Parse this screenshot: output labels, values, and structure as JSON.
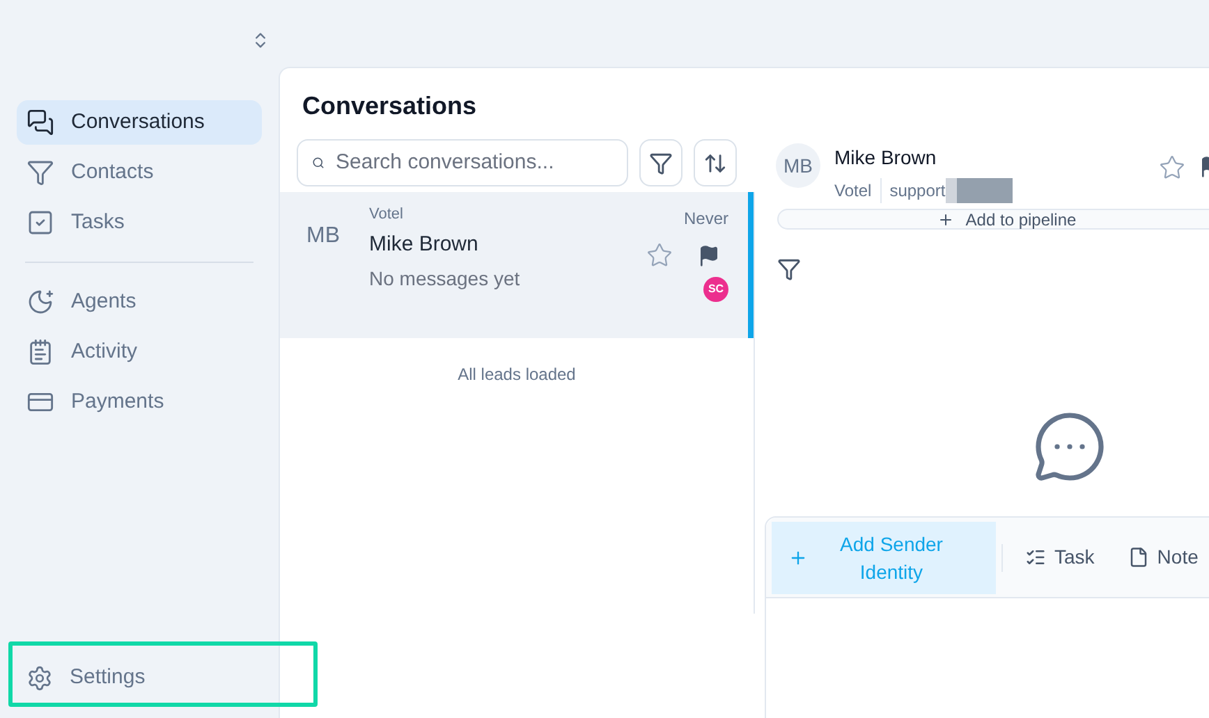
{
  "sidebar": {
    "items": [
      {
        "label": "Conversations",
        "selected": true
      },
      {
        "label": "Contacts",
        "selected": false
      },
      {
        "label": "Tasks",
        "selected": false
      }
    ],
    "items_2": [
      {
        "label": "Agents",
        "selected": false
      },
      {
        "label": "Activity",
        "selected": false
      },
      {
        "label": "Payments",
        "selected": false
      }
    ],
    "settings": {
      "label": "Settings",
      "highlighted": true
    }
  },
  "conversations": {
    "title": "Conversations",
    "search": {
      "placeholder": "Search conversations..."
    },
    "rows": [
      {
        "initials": "MB",
        "company": "Votel",
        "name": "Mike Brown",
        "preview": "No messages yet",
        "time": "Never",
        "selected": true,
        "starred": false,
        "agent": {
          "initials": "SC",
          "color": "#ec2f8e"
        }
      }
    ],
    "footer": "All leads loaded"
  },
  "chat": {
    "initials": "MB",
    "name": "Mike Brown",
    "company": "Votel",
    "email": "support",
    "starred": false,
    "pipeline_button": "Add to pipeline",
    "composer": {
      "sender_button": "Add Sender Identity",
      "tabs": [
        {
          "label": "Task",
          "selected": false
        },
        {
          "label": "Note",
          "selected": false
        }
      ]
    }
  }
}
